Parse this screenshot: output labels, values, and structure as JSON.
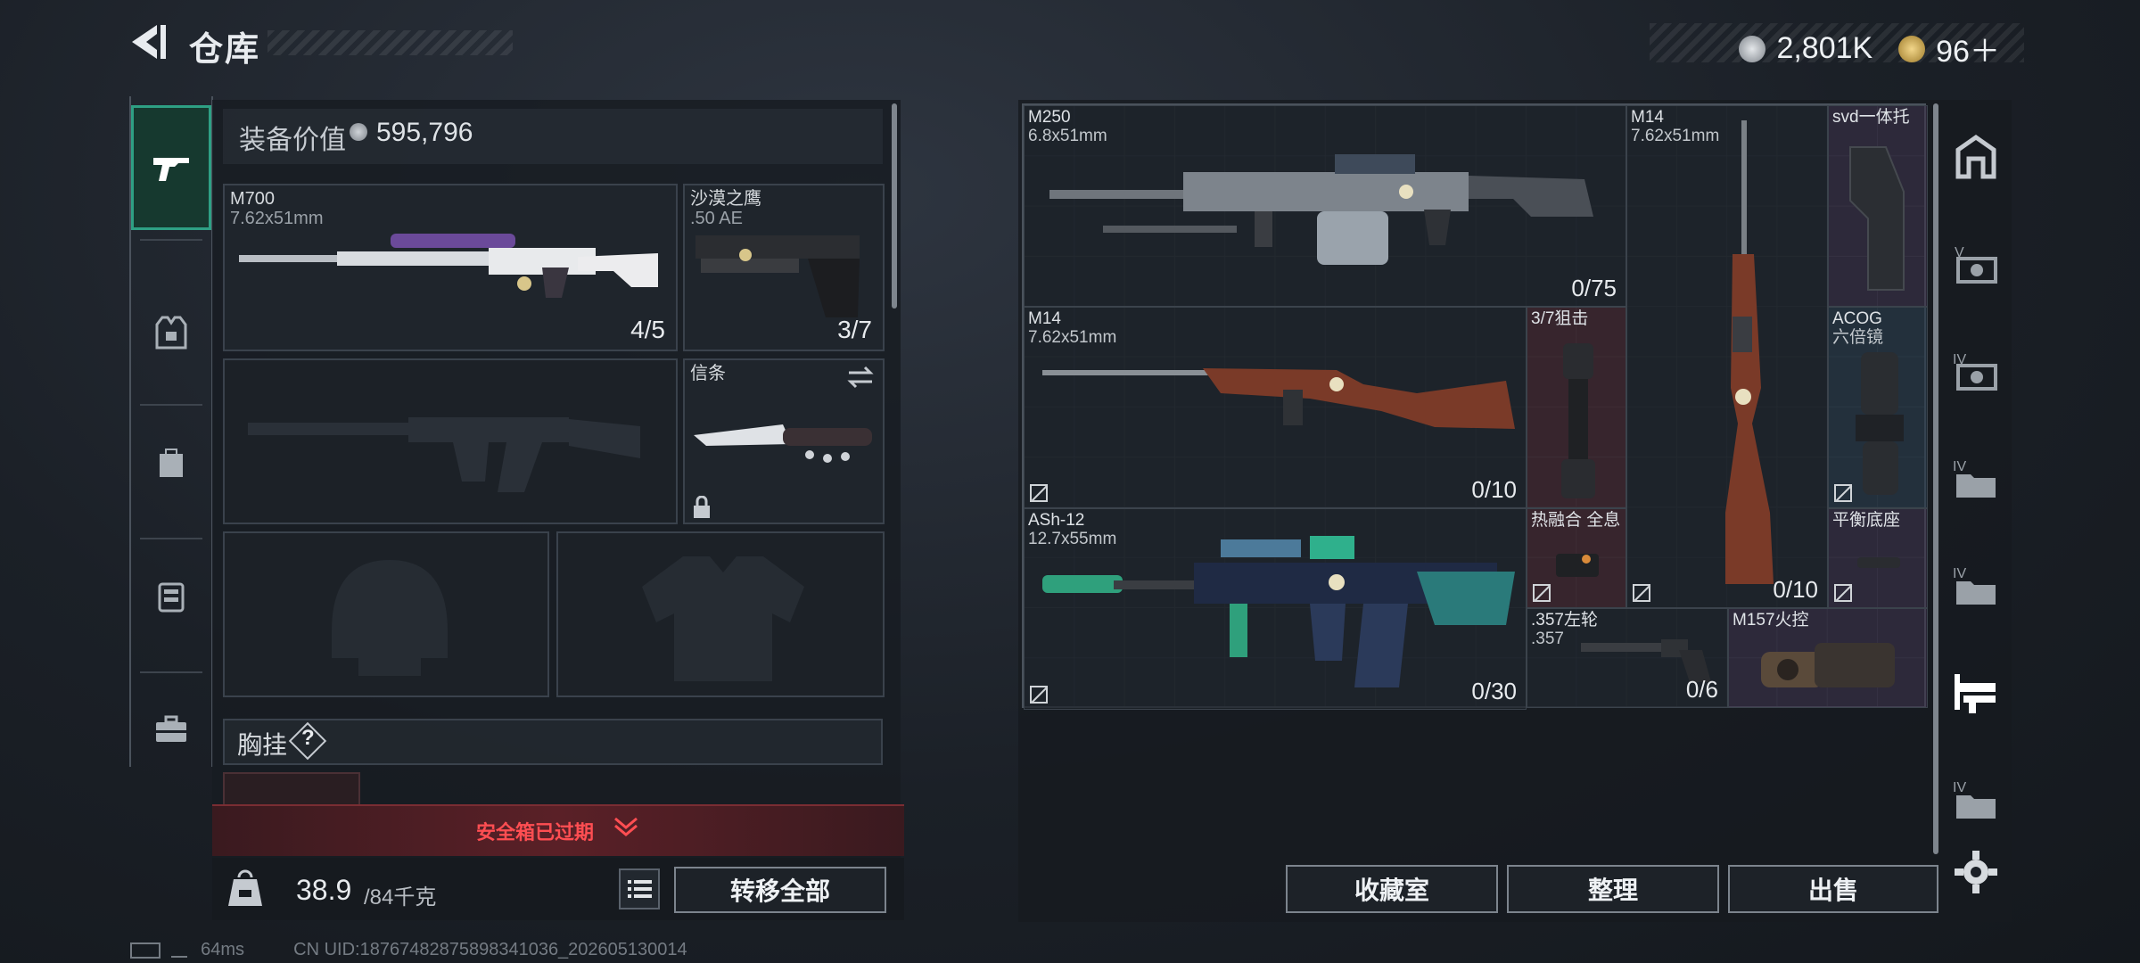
{
  "header": {
    "title": "仓库",
    "currency_silver": "2,801K",
    "currency_gold": "96＋"
  },
  "left": {
    "equip_value_label": "装备价值",
    "equip_value": "595,796",
    "slots": {
      "primary": {
        "name": "M700",
        "caliber": "7.62x51mm",
        "count": "4/5"
      },
      "pistol": {
        "name": "沙漠之鹰",
        "caliber": ".50 AE",
        "count": "3/7"
      },
      "melee": {
        "name": "信条"
      }
    },
    "chest_label": "胸挂",
    "chest_help": "?",
    "safe_box_text": "安全箱已过期",
    "weight_current": "38.9",
    "weight_max": "/84千克",
    "transfer_all": "转移全部"
  },
  "stash": {
    "items": [
      {
        "name": "M250",
        "sub": "6.8x51mm",
        "count": "0/75"
      },
      {
        "name": "M14",
        "sub": "7.62x51mm",
        "count": ""
      },
      {
        "name": "svd一体托",
        "sub": "",
        "count": ""
      },
      {
        "name": "M14",
        "sub": "7.62x51mm",
        "count": "0/10"
      },
      {
        "name": "3/7狙击",
        "sub": "",
        "count": ""
      },
      {
        "name": "ACOG",
        "sub": "六倍镜",
        "count": ""
      },
      {
        "name": "ASh-12",
        "sub": "12.7x55mm",
        "count": "0/30"
      },
      {
        "name": "热融合 全息",
        "sub": "",
        "count": ""
      },
      {
        "name": "平衡底座",
        "sub": "",
        "count": ""
      },
      {
        "name": ".357左轮",
        "sub": ".357",
        "count": "0/6"
      },
      {
        "name": "M157火控",
        "sub": "",
        "count": ""
      },
      {
        "name": "",
        "sub": "",
        "count": "0/10"
      }
    ],
    "buttons": {
      "collection": "收藏室",
      "sort": "整理",
      "sell": "出售"
    }
  },
  "status": {
    "ping": "64ms",
    "uid": "CN UID:187674828758983410​36_202605130014"
  },
  "colors": {
    "accent": "#2ea084",
    "warning": "#ff4e52"
  }
}
